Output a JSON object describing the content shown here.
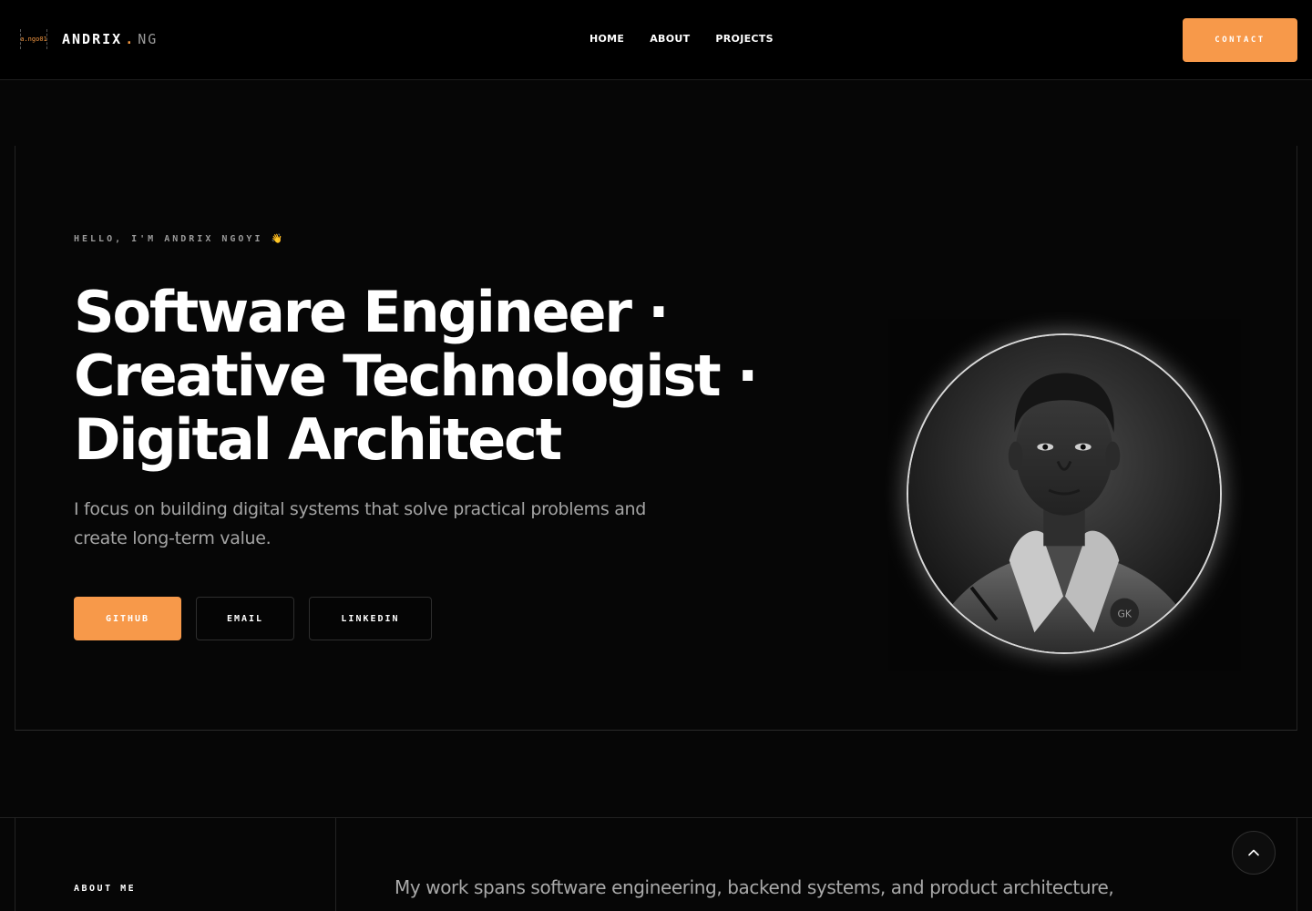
{
  "nav": {
    "brand_mark": "a.ngo01",
    "brand_name": "ANDRIX",
    "brand_dot": ".",
    "brand_suffix": "NG",
    "links": [
      {
        "label": "HOME"
      },
      {
        "label": "ABOUT"
      },
      {
        "label": "PROJECTS"
      }
    ],
    "contact_label": "CONTACT"
  },
  "hero": {
    "eyebrow": "HELLO, I'M ANDRIX NGOYI 👋",
    "headline_lines": [
      "Software Engineer ·",
      "Creative Technologist ·",
      "Digital Architect"
    ],
    "subtext": "I focus on building digital systems that solve practical problems and create long-term value.",
    "buttons": {
      "github": "GITHUB",
      "email": "EMAIL",
      "linkedin": "LINKEDIN"
    }
  },
  "about": {
    "label": "ABOUT ME",
    "text": "My work spans software engineering, backend systems, and product architecture,"
  },
  "colors": {
    "accent": "#f7994a",
    "background": "#060606",
    "muted_text": "#a4a4a4"
  },
  "icons": {
    "scroll_top": "chevron-up-icon",
    "portrait": "profile-photo"
  }
}
